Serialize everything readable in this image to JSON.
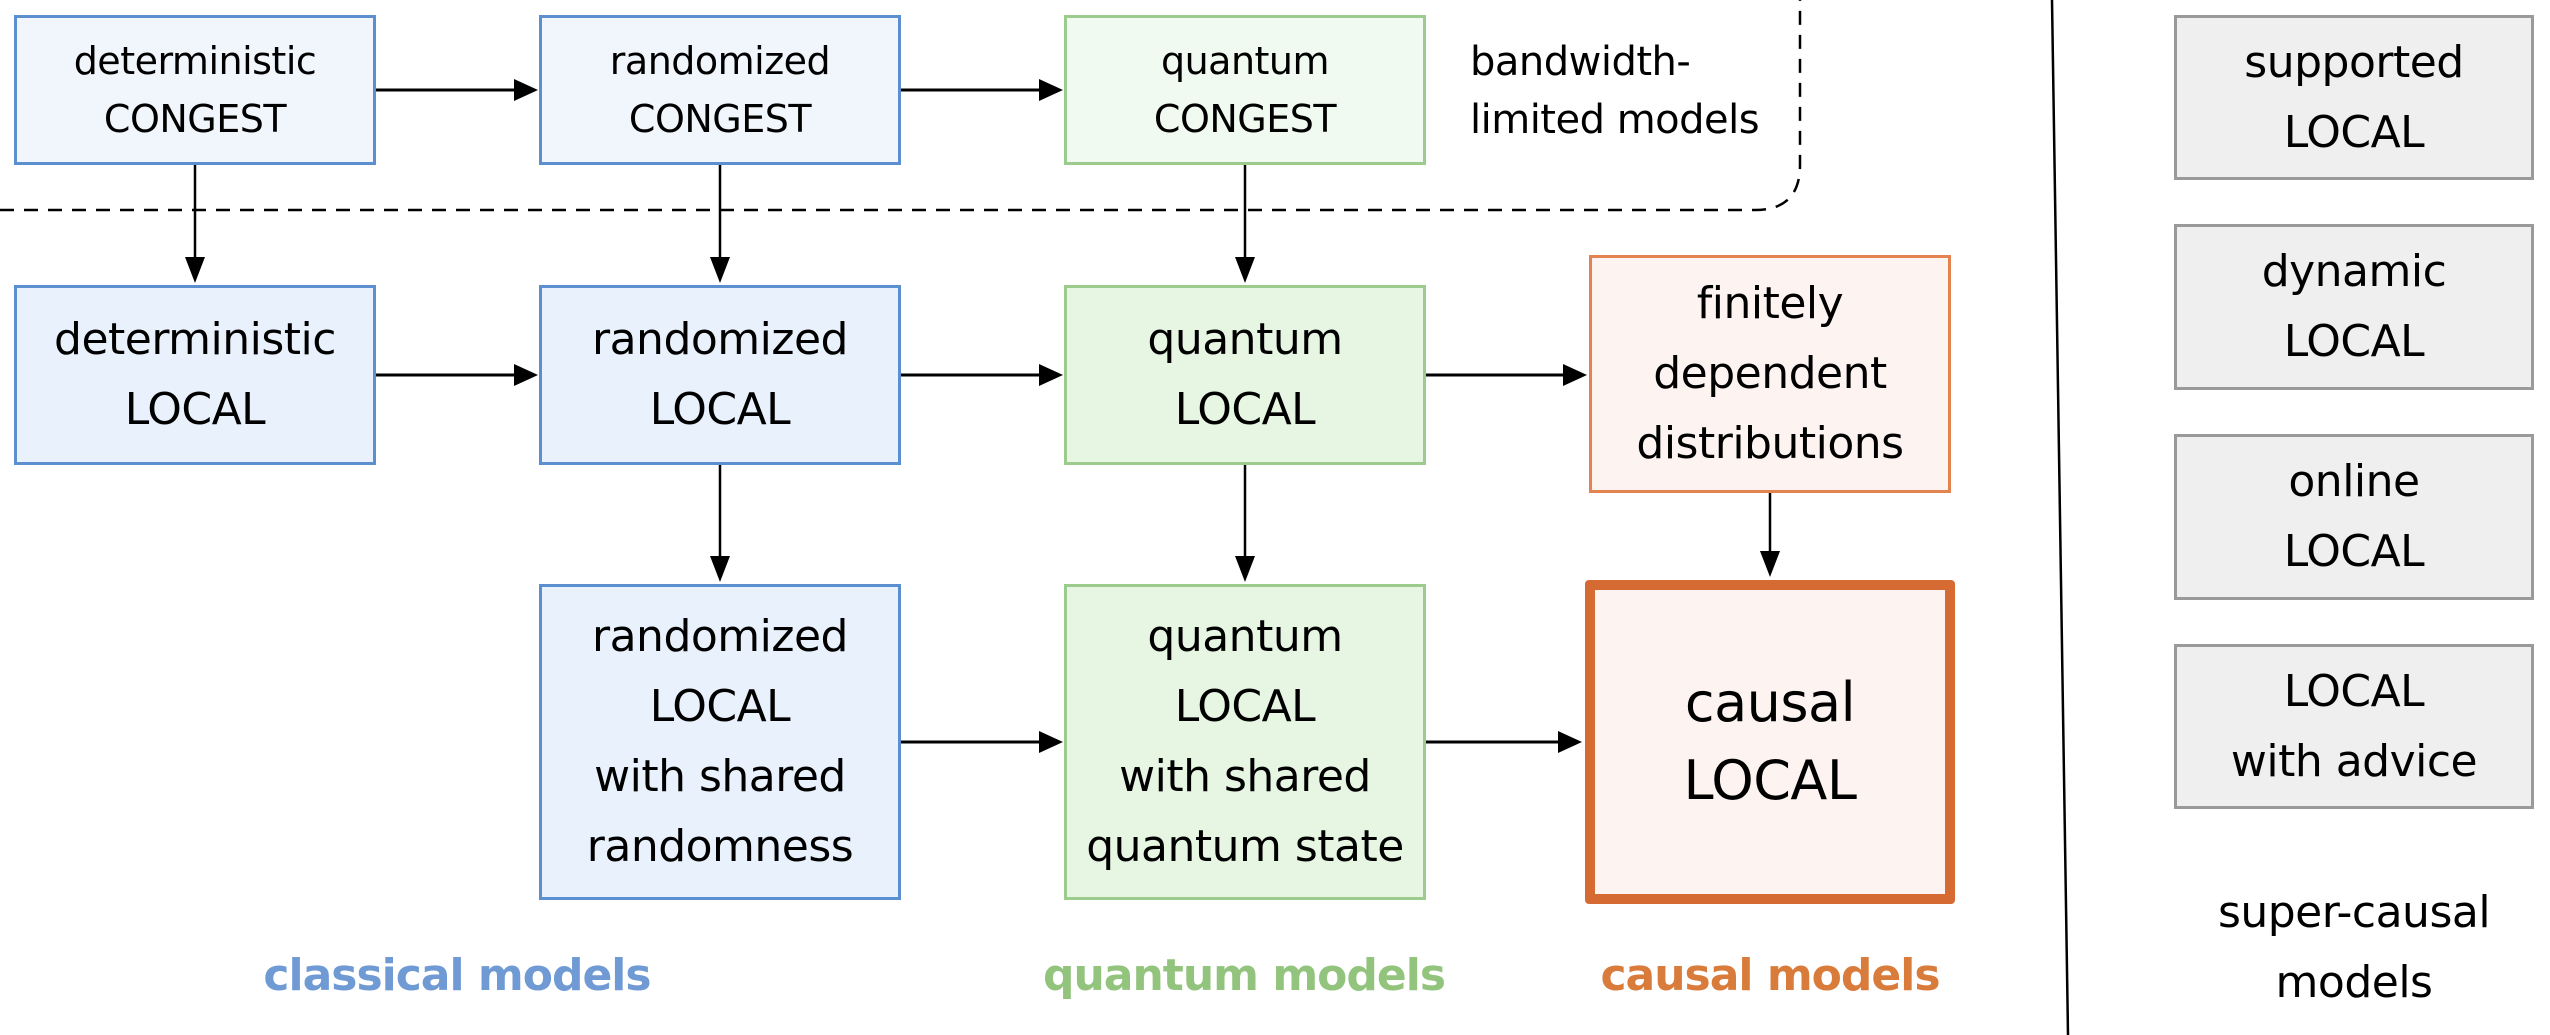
{
  "colors": {
    "classical": "#6F9AD4",
    "quantum": "#93C47D",
    "causal": "#D97B3A",
    "supercausal_border": "#9A9A9A",
    "arrow": "#000000"
  },
  "bandwidth_region": {
    "line1": "bandwidth-",
    "line2": "limited models"
  },
  "nodes": {
    "det_congest": {
      "line1": "deterministic",
      "line2": "CONGEST"
    },
    "rand_congest": {
      "line1": "randomized",
      "line2": "CONGEST"
    },
    "quant_congest": {
      "line1": "quantum",
      "line2": "CONGEST"
    },
    "det_local": {
      "line1": "deterministic",
      "line2": "LOCAL"
    },
    "rand_local": {
      "line1": "randomized",
      "line2": "LOCAL"
    },
    "quant_local": {
      "line1": "quantum",
      "line2": "LOCAL"
    },
    "finitely_dependent": {
      "line1": "finitely",
      "line2": "dependent",
      "line3": "distributions"
    },
    "rand_local_shared": {
      "line1": "randomized",
      "line2": "LOCAL",
      "line3": "with shared",
      "line4": "randomness"
    },
    "quant_local_shared": {
      "line1": "quantum",
      "line2": "LOCAL",
      "line3": "with shared",
      "line4": "quantum state"
    },
    "causal_local": {
      "line1": "causal",
      "line2": "LOCAL"
    }
  },
  "supercausal": {
    "boxes": [
      {
        "line1": "supported",
        "line2": "LOCAL"
      },
      {
        "line1": "dynamic",
        "line2": "LOCAL"
      },
      {
        "line1": "online",
        "line2": "LOCAL"
      },
      {
        "line1": "LOCAL",
        "line2": "with advice"
      }
    ],
    "label_line1": "super-causal",
    "label_line2": "models"
  },
  "category_labels": {
    "classical": "classical models",
    "quantum": "quantum models",
    "causal": "causal models"
  },
  "edges": [
    [
      "det_congest",
      "rand_congest"
    ],
    [
      "rand_congest",
      "quant_congest"
    ],
    [
      "det_congest",
      "det_local"
    ],
    [
      "rand_congest",
      "rand_local"
    ],
    [
      "quant_congest",
      "quant_local"
    ],
    [
      "det_local",
      "rand_local"
    ],
    [
      "rand_local",
      "quant_local"
    ],
    [
      "quant_local",
      "finitely_dependent"
    ],
    [
      "rand_local",
      "rand_local_shared"
    ],
    [
      "quant_local",
      "quant_local_shared"
    ],
    [
      "finitely_dependent",
      "causal_local"
    ],
    [
      "rand_local_shared",
      "quant_local_shared"
    ],
    [
      "quant_local_shared",
      "causal_local"
    ]
  ]
}
